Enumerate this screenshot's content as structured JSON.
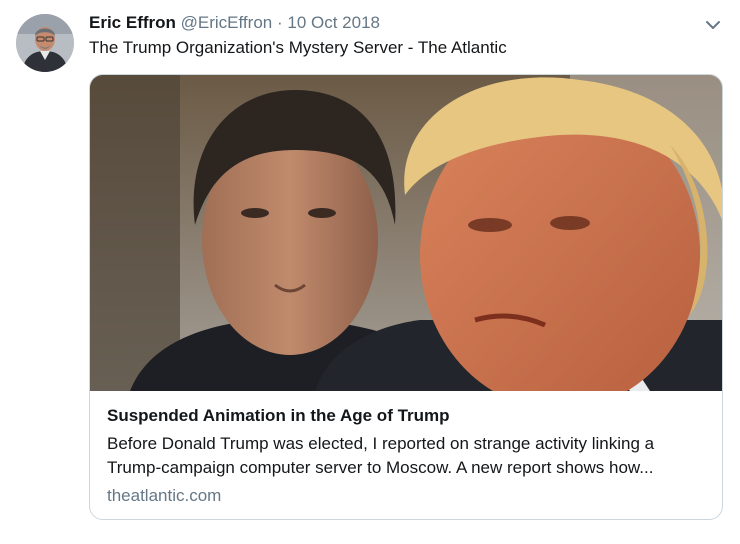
{
  "tweet": {
    "author": {
      "name": "Eric Effron",
      "handle": "@EricEffron"
    },
    "separator": "·",
    "date": "10 Oct 2018",
    "text": "The Trump Organization's Mystery Server - The Atlantic",
    "menu_icon": "chevron-down-icon"
  },
  "card": {
    "title": "Suspended Animation in the Age of Trump",
    "description_line1": "Before Donald Trump was elected, I reported on strange activity linking a",
    "description_line2": "Trump-campaign computer server to Moscow. A new report shows how...",
    "domain": "theatlantic.com"
  },
  "colors": {
    "text": "#14171a",
    "secondary": "#657786",
    "border": "#ccd6dd"
  }
}
